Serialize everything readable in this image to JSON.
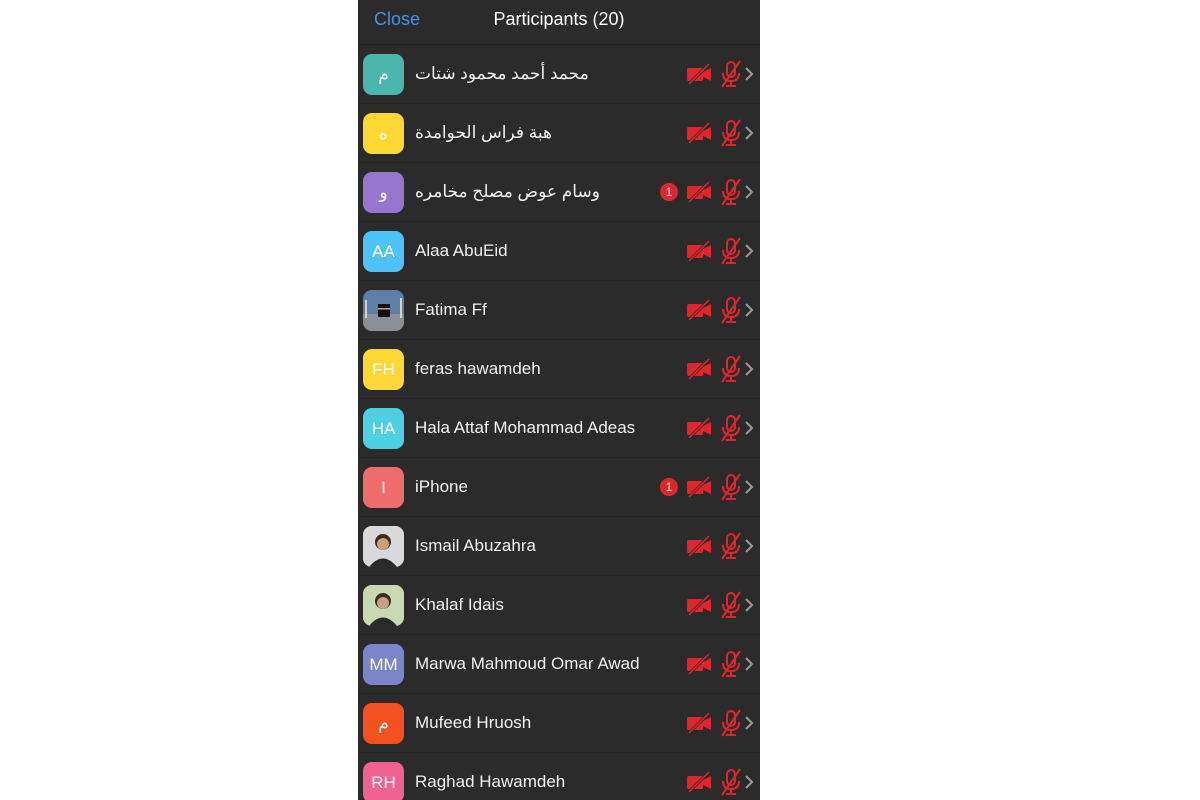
{
  "header": {
    "close_label": "Close",
    "title": "Participants (20)"
  },
  "colors": {
    "accent": "#4a90e2",
    "muted_red": "#e0262b",
    "background": "#2b2b2b"
  },
  "participants": [
    {
      "initials": "م",
      "name": "محمد أحمد محمود شتات",
      "avatar_color": "#4db6ac",
      "avatar_type": "initials",
      "badge": ""
    },
    {
      "initials": "ه",
      "name": "هبة فراس الحوامدة",
      "avatar_color": "#fdd835",
      "avatar_type": "initials",
      "badge": ""
    },
    {
      "initials": "و",
      "name": "وسام عوض مصلح مخامره",
      "avatar_color": "#9575cd",
      "avatar_type": "initials",
      "badge": "1"
    },
    {
      "initials": "AA",
      "name": "Alaa AbuEid",
      "avatar_color": "#4fc3f7",
      "avatar_type": "initials",
      "badge": ""
    },
    {
      "initials": "",
      "name": "Fatima Ff",
      "avatar_color": "#3d5a80",
      "avatar_type": "photo-kaaba",
      "badge": ""
    },
    {
      "initials": "FH",
      "name": "feras hawamdeh",
      "avatar_color": "#fdd835",
      "avatar_type": "initials",
      "badge": ""
    },
    {
      "initials": "HA",
      "name": "Hala Attaf Mohammad Adeas",
      "avatar_color": "#4dd0e1",
      "avatar_type": "initials",
      "badge": ""
    },
    {
      "initials": "I",
      "name": "iPhone",
      "avatar_color": "#ef6c6c",
      "avatar_type": "initials",
      "badge": "1"
    },
    {
      "initials": "",
      "name": "Ismail Abuzahra",
      "avatar_color": "#d9d9d9",
      "avatar_type": "photo-person",
      "badge": ""
    },
    {
      "initials": "",
      "name": "Khalaf Idais",
      "avatar_color": "#c8d8b0",
      "avatar_type": "photo-person",
      "badge": ""
    },
    {
      "initials": "MM",
      "name": "Marwa Mahmoud Omar Awad",
      "avatar_color": "#7986cb",
      "avatar_type": "initials",
      "badge": ""
    },
    {
      "initials": "م",
      "name": "Mufeed Hruosh",
      "avatar_color": "#f4511e",
      "avatar_type": "initials",
      "badge": ""
    },
    {
      "initials": "RH",
      "name": "Raghad Hawamdeh",
      "avatar_color": "#f06292",
      "avatar_type": "initials",
      "badge": ""
    }
  ],
  "icons": {
    "video": "video-off-icon",
    "mic": "mic-off-icon",
    "chevron": "chevron-right-icon"
  }
}
